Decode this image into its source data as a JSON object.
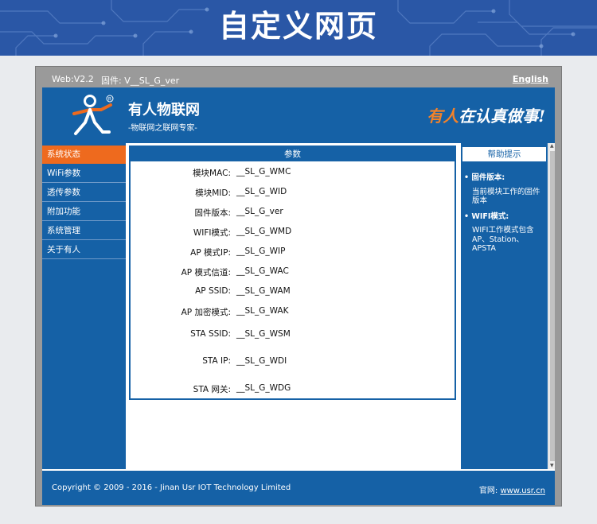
{
  "banner": {
    "title": "自定义网页"
  },
  "topbar": {
    "web_version": "Web:V2.2",
    "firmware": "固件: V__SL_G_ver",
    "language_link": "English"
  },
  "header": {
    "brand_name": "有人物联网",
    "brand_tagline": "-物联网之联网专家-",
    "slogan_highlight": "有人",
    "slogan_rest": "在认真做事!"
  },
  "nav": {
    "items": [
      {
        "label": "系统状态"
      },
      {
        "label": "WiFi参数"
      },
      {
        "label": "透传参数"
      },
      {
        "label": "附加功能"
      },
      {
        "label": "系统管理"
      },
      {
        "label": "关于有人"
      }
    ]
  },
  "params": {
    "title": "参数",
    "rows": [
      {
        "label": "模块MAC:",
        "value": "__SL_G_WMC"
      },
      {
        "label": "模块MID:",
        "value": "__SL_G_WID"
      },
      {
        "label": "固件版本:",
        "value": "__SL_G_ver"
      },
      {
        "label": "WIFI模式:",
        "value": "__SL_G_WMD"
      },
      {
        "label": "AP 模式IP:",
        "value": "__SL_G_WIP"
      },
      {
        "label": "AP 模式信道:",
        "value": "__SL_G_WAC"
      },
      {
        "label": "AP SSID:",
        "value": "__SL_G_WAM"
      },
      {
        "label": "AP 加密模式:",
        "value": "__SL_G_WAK"
      },
      {
        "label": "STA SSID:",
        "value": "__SL_G_WSM"
      },
      {
        "label": "STA IP:",
        "value": "__SL_G_WDI"
      },
      {
        "label": "STA 网关:",
        "value": "__SL_G_WDG"
      }
    ]
  },
  "help": {
    "title": "帮助提示",
    "items": [
      {
        "heading": "固件版本:",
        "text": "当前模块工作的固件版本"
      },
      {
        "heading": "WIFI模式:",
        "text": "WIFI工作模式包含AP、Station、APSTA"
      }
    ]
  },
  "footer": {
    "copyright": "Copyright © 2009 - 2016 - Jinan Usr IOT Technology Limited",
    "site_label": "官网:",
    "site_link": "www.usr.cn"
  },
  "colors": {
    "primary_blue": "#1561a6",
    "active_orange": "#ee6a1e",
    "banner_blue": "#2a57a6"
  }
}
